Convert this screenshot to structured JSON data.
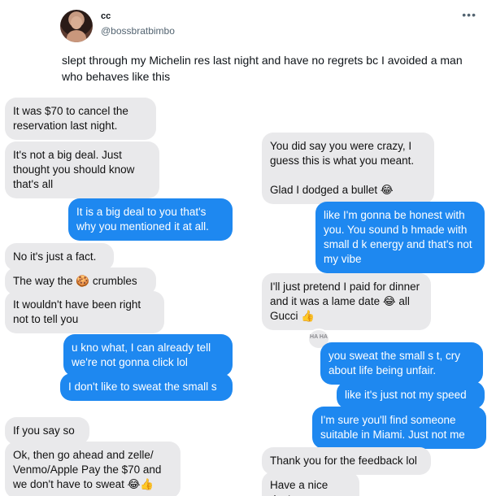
{
  "tweet": {
    "display_name": "cc",
    "handle": "@bossbratbimbo",
    "more_icon": "more-horizontal-icon",
    "text": "slept through my Michelin res last night and have no regrets bc I avoided a man who behaves like this"
  },
  "conversation": {
    "left_column": [
      {
        "side": "received",
        "text": "It was $70 to cancel the reservation last night."
      },
      {
        "side": "received",
        "text": "It's not a big deal. Just thought you should know that's all"
      },
      {
        "side": "sent",
        "text": "It is a big deal to you that's why you mentioned it at all."
      },
      {
        "side": "received",
        "text": "No it's just a fact."
      },
      {
        "side": "received",
        "text": "The way the 🍪 crumbles"
      },
      {
        "side": "received",
        "text": "It wouldn't have been right not to tell you"
      },
      {
        "side": "sent",
        "text": "u kno what, I can already tell we're not gonna click lol"
      },
      {
        "side": "sent",
        "text": "I don't like to sweat the small s"
      },
      {
        "side": "received",
        "text": "If you say so"
      },
      {
        "side": "received",
        "text": "Ok, then go ahead and zelle/ Venmo/Apple Pay the $70 and we don't have to sweat 😂👍"
      }
    ],
    "right_column": [
      {
        "side": "received",
        "text": "You did say you were crazy, I guess this is what you meant.\n\nGlad I dodged a bullet 😂"
      },
      {
        "side": "sent",
        "text": "like I'm gonna be honest with you. You sound b    hmade with small d   k energy and that's not my vibe"
      },
      {
        "side": "received",
        "text": "I'll just pretend I paid for dinner and it was a lame date 😂 all Gucci 👍"
      },
      {
        "side": "sent",
        "text": "you sweat the small s   t, cry about life being unfair."
      },
      {
        "side": "sent",
        "text": "like it's just not my speed"
      },
      {
        "side": "sent",
        "text": "I'm sure you'll find someone suitable in Miami. Just not me"
      },
      {
        "side": "received",
        "text": "Thank you for the feedback lol"
      },
      {
        "side": "received",
        "text": "Have a nice day!"
      }
    ],
    "reaction": {
      "label": "HA HA",
      "icon": "haha-tapback-icon"
    }
  },
  "colors": {
    "received_bubble": "#e9e9eb",
    "sent_bubble": "#1e88f0",
    "handle_text": "#536471"
  }
}
